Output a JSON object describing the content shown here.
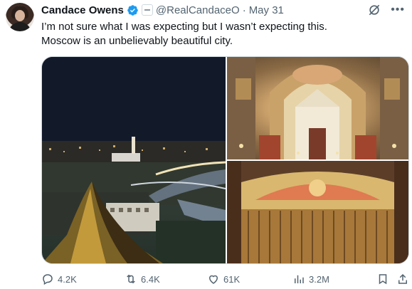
{
  "author": {
    "name": "Candace Owens",
    "handle": "@RealCandaceO",
    "separator": "·",
    "date": "May 31"
  },
  "tweet": {
    "line1": "I’m not sure what I was expecting but I wasn’t expecting this.",
    "line2": "Moscow is an unbelievably beautiful city."
  },
  "media": {
    "photos": [
      "moscow-city-night-view",
      "cathedral-interior-ceiling",
      "theatre-curtain-stage"
    ]
  },
  "actions": {
    "replies": "4.2K",
    "reposts": "6.4K",
    "likes": "61K",
    "views": "3.2M"
  },
  "colors": {
    "text": "#0f1419",
    "muted": "#536471",
    "verified": "#1d9bf0",
    "border": "#cfd9de"
  }
}
